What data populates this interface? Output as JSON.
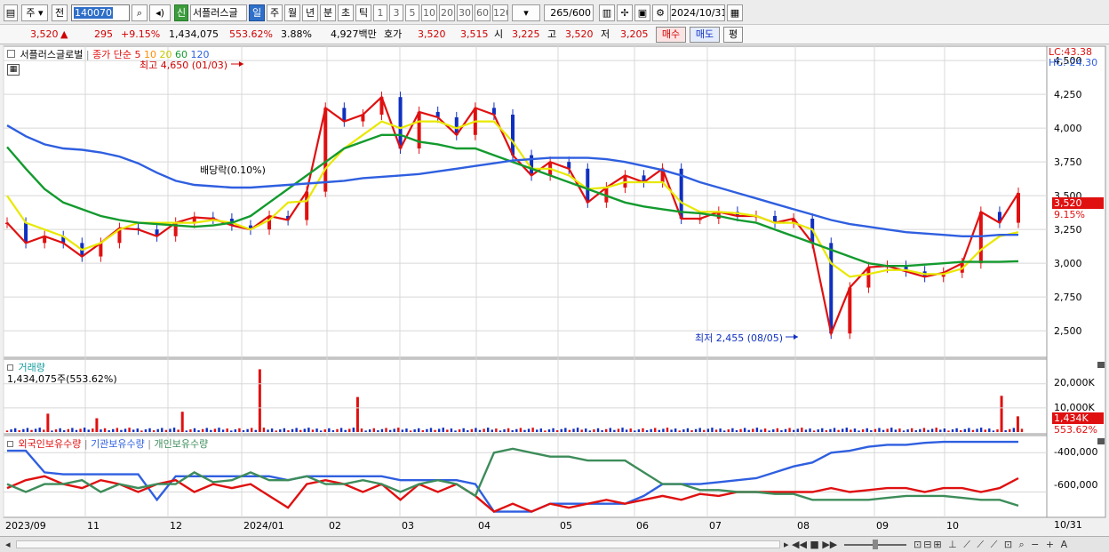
{
  "toolbar": {
    "type_label": "주",
    "period_label": "전",
    "code": "140070",
    "stock_name": "서플러스글",
    "badge_new": "신",
    "periods": [
      "일",
      "주",
      "월",
      "년",
      "분",
      "초",
      "틱"
    ],
    "active_period": "일",
    "counts": [
      "1",
      "3",
      "5",
      "10",
      "20",
      "30",
      "60",
      "120"
    ],
    "range": "265",
    "range_total": "/600",
    "date": "2024/10/31"
  },
  "quote": {
    "price": "3,520",
    "change_arrow": "▲",
    "change": "295",
    "change_pct": "+9.15%",
    "volume": "1,434,075",
    "volume_ratio": "553.62%",
    "turnover": "3.88%",
    "amount": "4,927백만",
    "bid_label": "호가",
    "ask": "3,520",
    "bid": "3,515",
    "open_label": "시",
    "open": "3,225",
    "high_label": "고",
    "high": "3,520",
    "low_label": "저",
    "low": "3,205",
    "buy_label": "매수",
    "sell_label": "매도",
    "eval_label": "평"
  },
  "chart_data": [
    {
      "type": "line",
      "title": "서플러스글로벌",
      "legend": [
        "종가 단순 5",
        "10",
        "20",
        "60",
        "120"
      ],
      "legend_colors": [
        "#e01010",
        "#ff8c00",
        "#e8e800",
        "#139a2e",
        "#2f5fe0"
      ],
      "x_ticks": [
        "2023/09",
        "11",
        "12",
        "2024/01",
        "02",
        "03",
        "04",
        "05",
        "06",
        "07",
        "08",
        "09",
        "10"
      ],
      "x_right_label": "10/31",
      "y_ticks": [
        4500,
        4250,
        4000,
        3750,
        3500,
        3250,
        3000,
        2750,
        2500
      ],
      "ylim": [
        2330,
        4580
      ],
      "top_right_labels": [
        "LC:43.38",
        "HC:-24.30"
      ],
      "price_label": "3,520",
      "price_change_label": "9.15%",
      "annotations": {
        "high": "최고 4,650 (01/03)",
        "low": "최저 2,455 (08/05)",
        "dividend": "배당락(0.10%)"
      },
      "series": [
        {
          "name": "종가",
          "values": [
            3300,
            3150,
            3200,
            3150,
            3050,
            3150,
            3260,
            3250,
            3200,
            3300,
            3340,
            3330,
            3280,
            3250,
            3350,
            3320,
            3530,
            4150,
            4050,
            4100,
            4230,
            3850,
            4120,
            4080,
            3950,
            4150,
            4100,
            3800,
            3650,
            3750,
            3700,
            3450,
            3560,
            3650,
            3600,
            3700,
            3330,
            3330,
            3380,
            3350,
            3350,
            3300,
            3330,
            3150,
            2480,
            2820,
            2970,
            2980,
            2940,
            2900,
            2930,
            3000,
            3380,
            3300,
            3520
          ]
        },
        {
          "name": "20",
          "values": [
            3500,
            3300,
            3250,
            3200,
            3100,
            3150,
            3250,
            3300,
            3300,
            3300,
            3300,
            3320,
            3300,
            3250,
            3320,
            3450,
            3460,
            3700,
            3850,
            3950,
            4050,
            4000,
            4050,
            4050,
            4000,
            4050,
            4050,
            3900,
            3700,
            3700,
            3650,
            3550,
            3560,
            3600,
            3600,
            3600,
            3450,
            3380,
            3380,
            3370,
            3350,
            3300,
            3300,
            3250,
            3000,
            2900,
            2920,
            2950,
            2950,
            2920,
            2920,
            2960,
            3100,
            3200,
            3230
          ]
        },
        {
          "name": "60",
          "values": [
            3860,
            3700,
            3550,
            3450,
            3400,
            3350,
            3320,
            3300,
            3290,
            3280,
            3270,
            3280,
            3300,
            3350,
            3450,
            3550,
            3650,
            3750,
            3850,
            3900,
            3950,
            3950,
            3900,
            3880,
            3850,
            3850,
            3800,
            3750,
            3700,
            3650,
            3600,
            3550,
            3500,
            3450,
            3420,
            3400,
            3380,
            3370,
            3350,
            3320,
            3300,
            3250,
            3200,
            3150,
            3100,
            3050,
            3000,
            2980,
            2980,
            2990,
            3000,
            3010,
            3010,
            3010,
            3015
          ]
        },
        {
          "name": "120",
          "values": [
            4020,
            3940,
            3880,
            3850,
            3840,
            3820,
            3790,
            3740,
            3670,
            3610,
            3580,
            3570,
            3560,
            3560,
            3570,
            3580,
            3590,
            3600,
            3610,
            3630,
            3640,
            3650,
            3660,
            3680,
            3700,
            3720,
            3740,
            3760,
            3770,
            3780,
            3780,
            3780,
            3770,
            3750,
            3720,
            3690,
            3650,
            3600,
            3560,
            3520,
            3480,
            3440,
            3400,
            3360,
            3320,
            3290,
            3270,
            3250,
            3230,
            3220,
            3210,
            3200,
            3200,
            3210,
            3210
          ]
        }
      ]
    },
    {
      "type": "bar",
      "title": "거래량",
      "summary": "1,434,075주(553.62%)",
      "y_ticks": [
        "20,000K",
        "10,000K"
      ],
      "current_label": "1,434K",
      "current_pct": "553.62%",
      "spikes": [
        {
          "x_index": 10,
          "value": 7600
        },
        {
          "x_index": 22,
          "value": 5700
        },
        {
          "x_index": 43,
          "value": 8400
        },
        {
          "x_index": 62,
          "value": 26000
        },
        {
          "x_index": 86,
          "value": 14500
        },
        {
          "x_index": 244,
          "value": 15000
        },
        {
          "x_index": 248,
          "value": 6500
        }
      ]
    },
    {
      "type": "line",
      "title": "외국인보유수량",
      "legend": [
        "외국인보유수량",
        "기관보유수량",
        "개인보유수량"
      ],
      "legend_colors": [
        "#e01010",
        "#2f5fe0",
        "#3d8c5a"
      ],
      "y_ticks": [
        "-400,000",
        "-600,000"
      ],
      "series": [
        {
          "name": "기관보유수량",
          "values": [
            -390,
            -390,
            -500,
            -510,
            -510,
            -510,
            -510,
            -510,
            -640,
            -520,
            -520,
            -520,
            -520,
            -520,
            -520,
            -540,
            -520,
            -520,
            -520,
            -520,
            -520,
            -540,
            -540,
            -540,
            -540,
            -560,
            -700,
            -700,
            -700,
            -660,
            -660,
            -660,
            -660,
            -660,
            -620,
            -560,
            -560,
            -560,
            -550,
            -540,
            -530,
            -500,
            -470,
            -450,
            -400,
            -390,
            -370,
            -360,
            -360,
            -350,
            -345,
            -345,
            -345,
            -345,
            -345
          ]
        },
        {
          "name": "외국인보유수량",
          "values": [
            -580,
            -540,
            -520,
            -560,
            -580,
            -540,
            -560,
            -600,
            -560,
            -540,
            -600,
            -560,
            -580,
            -560,
            -620,
            -680,
            -560,
            -540,
            -560,
            -600,
            -560,
            -640,
            -560,
            -600,
            -560,
            -620,
            -700,
            -660,
            -700,
            -660,
            -680,
            -660,
            -640,
            -660,
            -640,
            -620,
            -640,
            -610,
            -620,
            -600,
            -600,
            -600,
            -600,
            -600,
            -580,
            -600,
            -590,
            -580,
            -580,
            -600,
            -580,
            -580,
            -600,
            -580,
            -530
          ]
        },
        {
          "name": "개인보유수량",
          "values": [
            -560,
            -600,
            -560,
            -560,
            -540,
            -600,
            -560,
            -580,
            -560,
            -560,
            -500,
            -550,
            -540,
            -500,
            -540,
            -540,
            -520,
            -560,
            -560,
            -540,
            -560,
            -600,
            -560,
            -540,
            -560,
            -620,
            -400,
            -380,
            -400,
            -420,
            -420,
            -440,
            -440,
            -440,
            -500,
            -560,
            -560,
            -590,
            -590,
            -600,
            -600,
            -610,
            -610,
            -640,
            -640,
            -640,
            -640,
            -630,
            -620,
            -620,
            -620,
            -630,
            -640,
            -640,
            -670
          ]
        }
      ]
    }
  ],
  "bottombar": {
    "scroll_left": "◂",
    "controls": "▸ ◀◀ ■ ▶▶"
  }
}
